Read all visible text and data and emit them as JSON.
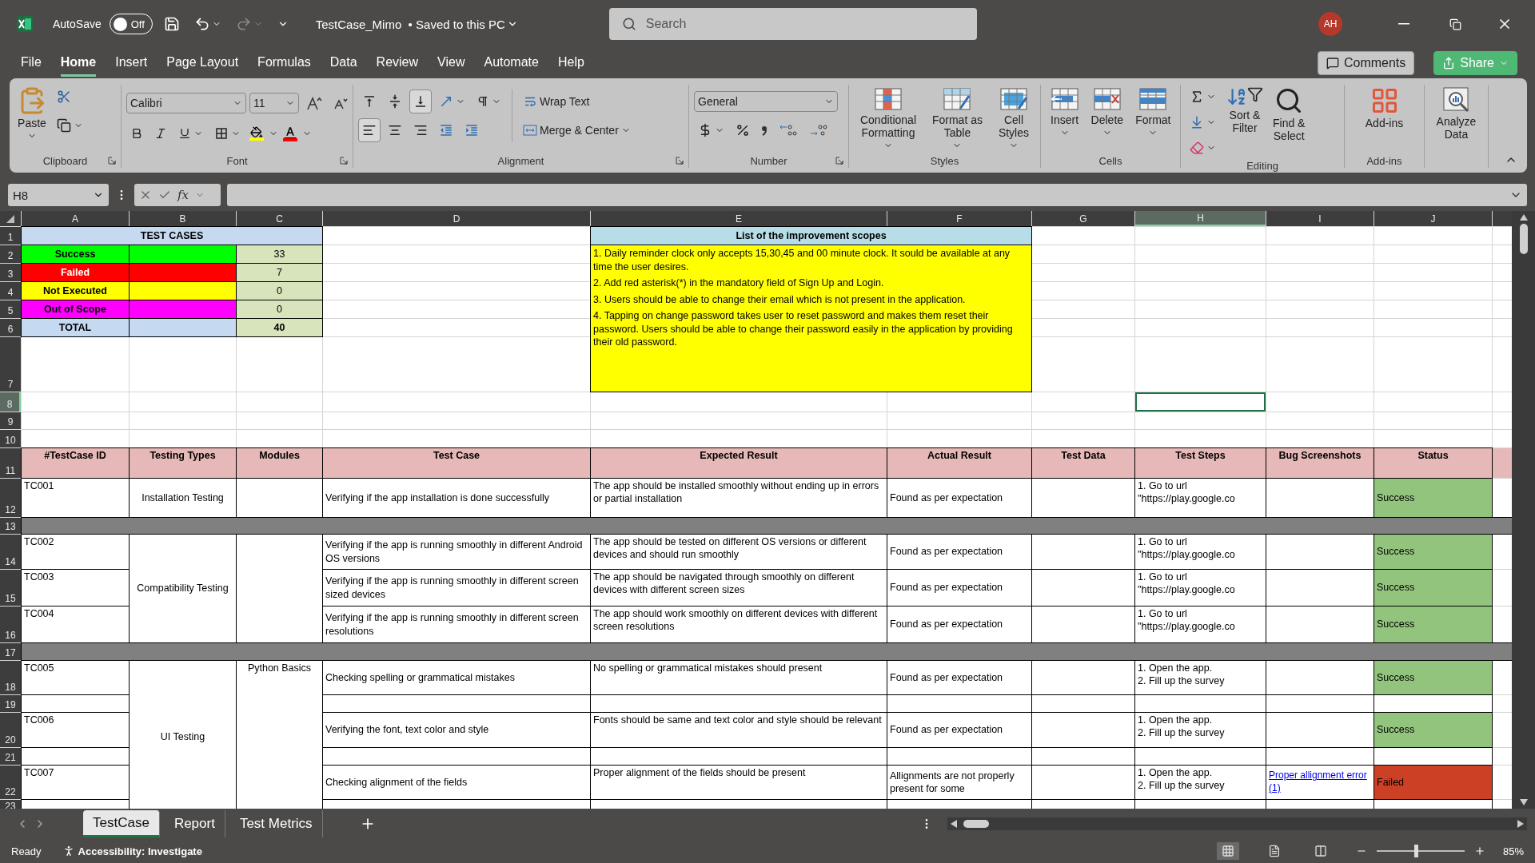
{
  "app": {
    "autosave_label": "AutoSave",
    "autosave_on": false,
    "autosave_state": "Off",
    "title": "TestCase_Mimo",
    "save_status": "• Saved to this PC",
    "search_placeholder": "Search",
    "user_initials": "AH"
  },
  "menu_tabs": [
    {
      "label": "File",
      "selected": false
    },
    {
      "label": "Home",
      "selected": true
    },
    {
      "label": "Insert",
      "selected": false
    },
    {
      "label": "Page Layout",
      "selected": false
    },
    {
      "label": "Formulas",
      "selected": false
    },
    {
      "label": "Data",
      "selected": false
    },
    {
      "label": "Review",
      "selected": false
    },
    {
      "label": "View",
      "selected": false
    },
    {
      "label": "Automate",
      "selected": false
    },
    {
      "label": "Help",
      "selected": false
    }
  ],
  "top_buttons": {
    "comments": "Comments",
    "share": "Share"
  },
  "ribbon": {
    "clipboard": {
      "paste": "Paste",
      "label": "Clipboard"
    },
    "font": {
      "family": "Calibri",
      "size": "11",
      "label": "Font"
    },
    "alignment": {
      "vertical_buttons": [
        {
          "kind": "top",
          "selected": false
        },
        {
          "kind": "middle",
          "selected": false
        },
        {
          "kind": "bottom",
          "selected": true
        }
      ],
      "horizontal_buttons": [
        {
          "kind": "left",
          "selected": true
        },
        {
          "kind": "center",
          "selected": false
        },
        {
          "kind": "right",
          "selected": false
        }
      ],
      "wrap": "Wrap Text",
      "merge": "Merge & Center",
      "label": "Alignment"
    },
    "number": {
      "format": "General",
      "label": "Number"
    },
    "styles": {
      "buttons": [
        "Conditional\nFormatting",
        "Format as\nTable",
        "Cell\nStyles"
      ],
      "label": "Styles"
    },
    "cells": {
      "buttons": [
        "Insert",
        "Delete",
        "Format"
      ],
      "label": "Cells"
    },
    "editing": {
      "buttons": [
        "Sort &\nFilter",
        "Find &\nSelect"
      ],
      "label": "Editing"
    },
    "addins": {
      "button": "Add-ins",
      "label": "Add-ins"
    },
    "analyze": {
      "button": "Analyze\nData"
    }
  },
  "formula_bar": {
    "name_box": "H8",
    "fx": "fx"
  },
  "sheet": {
    "columns": [
      {
        "letter": "A",
        "selected": false
      },
      {
        "letter": "B",
        "selected": false
      },
      {
        "letter": "C",
        "selected": false
      },
      {
        "letter": "D",
        "selected": false
      },
      {
        "letter": "E",
        "selected": false
      },
      {
        "letter": "F",
        "selected": false
      },
      {
        "letter": "G",
        "selected": false
      },
      {
        "letter": "H",
        "selected": true
      },
      {
        "letter": "I",
        "selected": false
      },
      {
        "letter": "J",
        "selected": false
      }
    ],
    "rows": [
      {
        "label": "1",
        "selected": false
      },
      {
        "label": "2",
        "selected": false
      },
      {
        "label": "3",
        "selected": false
      },
      {
        "label": "4",
        "selected": false
      },
      {
        "label": "5",
        "selected": false
      },
      {
        "label": "6",
        "selected": false
      },
      {
        "label": "7",
        "selected": false
      },
      {
        "label": "8",
        "selected": true
      },
      {
        "label": "9",
        "selected": false
      },
      {
        "label": "10",
        "selected": false
      },
      {
        "label": "11",
        "selected": false
      },
      {
        "label": "12",
        "selected": false
      },
      {
        "label": "13",
        "selected": false
      },
      {
        "label": "14",
        "selected": false
      },
      {
        "label": "15",
        "selected": false
      },
      {
        "label": "16",
        "selected": false
      },
      {
        "label": "17",
        "selected": false
      },
      {
        "label": "18",
        "selected": false
      },
      {
        "label": "19",
        "selected": false
      },
      {
        "label": "20",
        "selected": false
      },
      {
        "label": "21",
        "selected": false
      },
      {
        "label": "22",
        "selected": false
      },
      {
        "label": "23",
        "selected": false
      }
    ]
  },
  "summary": {
    "title": "TEST CASES",
    "items": [
      {
        "label": "Success",
        "color": "#00ff00",
        "count": "33"
      },
      {
        "label": "Failed",
        "color": "#ff0000",
        "count": "7"
      },
      {
        "label": "Not Executed",
        "color": "#ffff00",
        "count": "0"
      },
      {
        "label": "Out of Scope",
        "color": "#ff00ff",
        "count": "0"
      }
    ],
    "total": {
      "label": "TOTAL",
      "count": "40"
    }
  },
  "improvements": {
    "title": "List of the improvement scopes",
    "items": [
      "1. Daily reminder clock only accepts 15,30,45 and 00 minute clock. It sould be available at any time the user desires.",
      "2. Add red asterisk(*) in the mandatory field of Sign Up and Login.",
      "3. Users should be able to change their email which is not present in the application.",
      "4. Tapping on change password takes user to reset password and makes them reset their password. Users should be able to change their password easily in the application by providing their old password."
    ]
  },
  "table": {
    "headers": [
      "#TestCase ID",
      "Testing Types",
      "Modules",
      "Test Case",
      "Expected Result",
      "Actual Result",
      "Test Data",
      "Test Steps",
      "Bug Screenshots",
      "Status"
    ],
    "groups": [
      {
        "kind": "group",
        "testing_type": "Installation Testing",
        "rows": [
          {
            "kind": "case",
            "id": "TC001",
            "test_case": "Verifying if the app installation is done successfully",
            "expected": "The app should be installed smoothly without ending up in errors or partial installation",
            "actual": "Found as per expectation",
            "steps": "1. Go to url\n\"https://play.google.co",
            "status": "Success",
            "color": "#93c47d"
          }
        ]
      },
      {
        "kind": "separator"
      },
      {
        "kind": "group",
        "testing_type": "Compatibility Testing",
        "rows": [
          {
            "kind": "case",
            "id": "TC002",
            "test_case": "Verifying if the app is running smoothly in different Android OS versions",
            "expected": "The app should be tested on different OS versions or different devices and should run smoothly",
            "actual": "Found as per expectation",
            "steps": "1. Go to url\n\"https://play.google.co",
            "status": "Success",
            "color": "#93c47d"
          },
          {
            "kind": "case",
            "id": "TC003",
            "test_case": "Verifying if the app is running smoothly in different screen sized devices",
            "expected": "The app should be navigated through smoothly on different devices with different screen sizes",
            "actual": "Found as per expectation",
            "steps": "1. Go to url\n\"https://play.google.co",
            "status": "Success",
            "color": "#93c47d"
          },
          {
            "kind": "case",
            "id": "TC004",
            "test_case": "Verifying if the app is running smoothly in different screen resolutions",
            "expected": "The app should work smoothly on different devices with different screen resolutions",
            "actual": "Found as per expectation",
            "steps": "1. Go to url\n\"https://play.google.co",
            "status": "Success",
            "color": "#93c47d"
          }
        ]
      },
      {
        "kind": "separator"
      },
      {
        "kind": "group",
        "testing_type": "UI Testing",
        "module": "Python Basics",
        "rows": [
          {
            "kind": "case",
            "id": "TC005",
            "test_case": "Checking spelling or grammatical mistakes",
            "expected": "No spelling or grammatical mistakes should present",
            "actual": "Found as per expectation",
            "steps": "1. Open the app.\n2. Fill up the survey",
            "status": "Success",
            "color": "#93c47d"
          },
          {
            "kind": "blank"
          },
          {
            "kind": "case",
            "id": "TC006",
            "test_case": "Verifying the font, text color and style",
            "expected": "Fonts should be same and text color and style should be relevant",
            "actual": "Found as per expectation",
            "steps": "1. Open the app.\n2. Fill up the survey",
            "status": "Success",
            "color": "#93c47d"
          },
          {
            "kind": "blank"
          },
          {
            "kind": "case",
            "id": "TC007",
            "test_case": "Checking alignment of the fields",
            "expected": "Proper alignment of the fields should be present",
            "actual": "Allignments are not properly present for some",
            "steps": "1. Open the app.\n2. Fill up the survey",
            "bug": "Proper allignment error (1)",
            "status": "Failed",
            "color": "#cc4125"
          },
          {
            "kind": "blank"
          }
        ]
      }
    ]
  },
  "sheet_tabs": [
    {
      "label": "TestCase",
      "selected": true
    },
    {
      "label": "Report",
      "selected": false
    },
    {
      "label": "Test Metrics",
      "selected": false
    }
  ],
  "status_bar": {
    "ready": "Ready",
    "accessibility": "Accessibility: Investigate",
    "views": [
      {
        "kind": "normal",
        "selected": true
      },
      {
        "kind": "layout",
        "selected": false
      },
      {
        "kind": "break",
        "selected": false
      }
    ],
    "zoom": {
      "level": 0.45,
      "reading": "85%"
    }
  }
}
